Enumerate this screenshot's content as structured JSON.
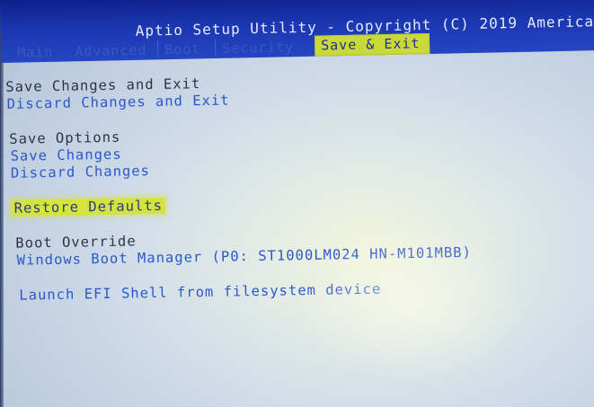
{
  "header": {
    "title": "Aptio Setup Utility - Copyright (C) 2019 America"
  },
  "tabs": [
    {
      "label": "Main"
    },
    {
      "label": "Advanced"
    },
    {
      "label": "Boot"
    },
    {
      "label": "Security"
    },
    {
      "label": "Save & Exit",
      "active": true
    }
  ],
  "menu": {
    "save_changes_and_exit": "Save Changes and Exit",
    "discard_changes_and_exit": "Discard Changes and Exit",
    "save_options_heading": "Save Options",
    "save_changes": "Save Changes",
    "discard_changes": "Discard Changes",
    "restore_defaults": "Restore Defaults",
    "boot_override_heading": "Boot Override",
    "windows_boot_manager": "Windows Boot Manager (P0: ST1000LM024 HN-M101MBB)",
    "launch_efi_shell": "Launch EFI Shell from filesystem device"
  },
  "colors": {
    "title_bar": "#1a36b0",
    "highlight": "#d4e33e",
    "option_text": "#2a58c9",
    "heading_text": "#2d3346"
  }
}
